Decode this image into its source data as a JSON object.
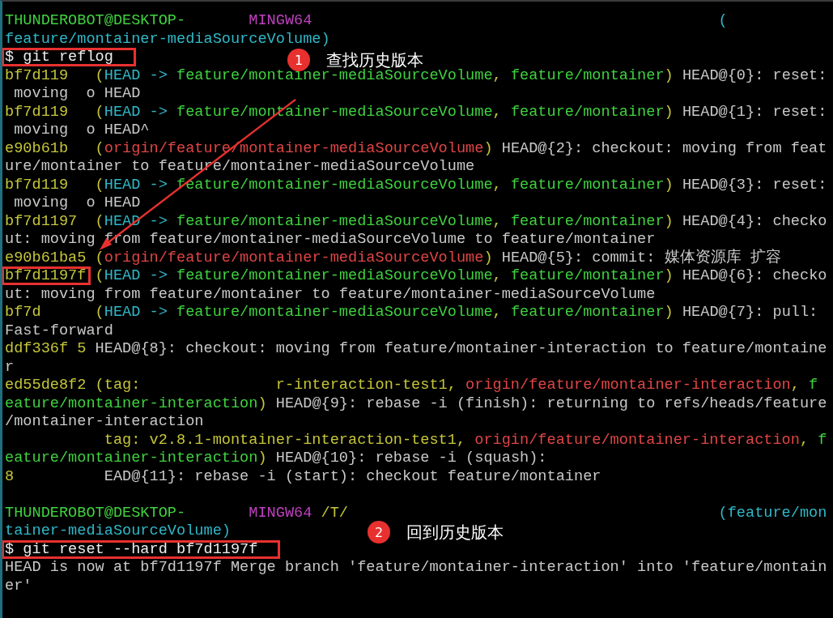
{
  "terminal": {
    "lines": [
      {
        "boxed": false,
        "segments": [
          {
            "text": "THUNDEROBOT@DESKTOP-",
            "color": "#3fd23f"
          },
          {
            "text": "       MINGW64",
            "color": "#c040c0"
          },
          {
            "text": "                                             (",
            "color": "#2fb8c8"
          }
        ]
      },
      {
        "boxed": false,
        "segments": [
          {
            "text": "feature/montainer-mediaSourceVolume)",
            "color": "#2fb8c8"
          }
        ]
      },
      {
        "boxed": true,
        "segments": [
          {
            "text": "$ git reflog",
            "color": "#ececec"
          }
        ]
      },
      {
        "boxed": false,
        "segments": [
          {
            "text": "bf7d119   (",
            "color": "#c5c53a"
          },
          {
            "text": "HEAD -> ",
            "color": "#2fb8c8"
          },
          {
            "text": "feature/montainer-mediaSourceVolume",
            "color": "#3fd23f"
          },
          {
            "text": ", ",
            "color": "#c5c53a"
          },
          {
            "text": "feature/montainer",
            "color": "#3fd23f"
          },
          {
            "text": ")",
            "color": "#c5c53a"
          },
          {
            "text": " HEAD@{0}: reset:",
            "color": "#c8c8c8"
          }
        ]
      },
      {
        "boxed": false,
        "segments": [
          {
            "text": " moving  o HEAD",
            "color": "#c8c8c8"
          }
        ]
      },
      {
        "boxed": false,
        "segments": [
          {
            "text": "bf7d119   (",
            "color": "#c5c53a"
          },
          {
            "text": "HEAD -> ",
            "color": "#2fb8c8"
          },
          {
            "text": "feature/montainer-mediaSourceVolume",
            "color": "#3fd23f"
          },
          {
            "text": ", ",
            "color": "#c5c53a"
          },
          {
            "text": "feature/montainer",
            "color": "#3fd23f"
          },
          {
            "text": ")",
            "color": "#c5c53a"
          },
          {
            "text": " HEAD@{1}: reset:",
            "color": "#c8c8c8"
          }
        ]
      },
      {
        "boxed": false,
        "segments": [
          {
            "text": " moving  o HEAD^",
            "color": "#c8c8c8"
          }
        ]
      },
      {
        "boxed": false,
        "segments": [
          {
            "text": "e90b61b   (",
            "color": "#c5c53a"
          },
          {
            "text": "origin/feature/montainer-mediaSourceVolume",
            "color": "#e04545"
          },
          {
            "text": ")",
            "color": "#c5c53a"
          },
          {
            "text": " HEAD@{2}: checkout: moving from feat",
            "color": "#c8c8c8"
          }
        ]
      },
      {
        "boxed": false,
        "segments": [
          {
            "text": "ure/montainer to feature/montainer-mediaSourceVolume",
            "color": "#c8c8c8"
          }
        ]
      },
      {
        "boxed": false,
        "segments": [
          {
            "text": "bf7d119   (",
            "color": "#c5c53a"
          },
          {
            "text": "HEAD -> ",
            "color": "#2fb8c8"
          },
          {
            "text": "feature/montainer-mediaSourceVolume",
            "color": "#3fd23f"
          },
          {
            "text": ", ",
            "color": "#c5c53a"
          },
          {
            "text": "feature/montainer",
            "color": "#3fd23f"
          },
          {
            "text": ")",
            "color": "#c5c53a"
          },
          {
            "text": " HEAD@{3}: reset:",
            "color": "#c8c8c8"
          }
        ]
      },
      {
        "boxed": false,
        "segments": [
          {
            "text": " moving  o HEAD",
            "color": "#c8c8c8"
          }
        ]
      },
      {
        "boxed": false,
        "segments": [
          {
            "text": "bf7d1197  (",
            "color": "#c5c53a"
          },
          {
            "text": "HEAD -> ",
            "color": "#2fb8c8"
          },
          {
            "text": "feature/montainer-mediaSourceVolume",
            "color": "#3fd23f"
          },
          {
            "text": ", ",
            "color": "#c5c53a"
          },
          {
            "text": "feature/montainer",
            "color": "#3fd23f"
          },
          {
            "text": ")",
            "color": "#c5c53a"
          },
          {
            "text": " HEAD@{4}: checko",
            "color": "#c8c8c8"
          }
        ]
      },
      {
        "boxed": false,
        "segments": [
          {
            "text": "ut: moving from feature/montainer-mediaSourceVolume to feature/montainer",
            "color": "#c8c8c8"
          }
        ]
      },
      {
        "boxed": false,
        "segments": [
          {
            "text": "e90b61ba5 (",
            "color": "#c5c53a"
          },
          {
            "text": "origin/feature/montainer-mediaSourceVolume",
            "color": "#e04545"
          },
          {
            "text": ")",
            "color": "#c5c53a"
          },
          {
            "text": " HEAD@{5}: commit: 媒体资源库 扩容",
            "color": "#c8c8c8"
          }
        ]
      },
      {
        "boxed": true,
        "segments": [
          {
            "text": "bf7d1197f",
            "color": "#c5c53a"
          },
          {
            "text": " (",
            "color": "#c5c53a"
          },
          {
            "text": "HEAD -> ",
            "color": "#2fb8c8"
          },
          {
            "text": "feature/montainer-mediaSourceVolume",
            "color": "#3fd23f"
          },
          {
            "text": ", ",
            "color": "#c5c53a"
          },
          {
            "text": "feature/montainer",
            "color": "#3fd23f"
          },
          {
            "text": ")",
            "color": "#c5c53a"
          },
          {
            "text": " HEAD@{6}: checko",
            "color": "#c8c8c8"
          }
        ]
      },
      {
        "boxed": false,
        "segments": [
          {
            "text": "ut: moving from feature/montainer to feature/montainer-mediaSourceVolume",
            "color": "#c8c8c8"
          }
        ]
      },
      {
        "boxed": false,
        "segments": [
          {
            "text": "bf7d      (",
            "color": "#c5c53a"
          },
          {
            "text": "HEAD -> ",
            "color": "#2fb8c8"
          },
          {
            "text": "feature/montainer-mediaSourceVolume",
            "color": "#3fd23f"
          },
          {
            "text": ", ",
            "color": "#c5c53a"
          },
          {
            "text": "feature/montainer",
            "color": "#3fd23f"
          },
          {
            "text": ")",
            "color": "#c5c53a"
          },
          {
            "text": " HEAD@{7}: pull:",
            "color": "#c8c8c8"
          }
        ]
      },
      {
        "boxed": false,
        "segments": [
          {
            "text": "Fast-forward",
            "color": "#c8c8c8"
          }
        ]
      },
      {
        "boxed": false,
        "segments": [
          {
            "text": "ddf336f 5",
            "color": "#c5c53a"
          },
          {
            "text": " HEAD@{8}: checkout: moving from feature/montainer-interaction to feature/montaine",
            "color": "#c8c8c8"
          }
        ]
      },
      {
        "boxed": false,
        "segments": [
          {
            "text": "r",
            "color": "#c8c8c8"
          }
        ]
      },
      {
        "boxed": false,
        "segments": [
          {
            "text": "ed55de8f2 (tag:               r-interaction-test1",
            "color": "#c5c53a"
          },
          {
            "text": ", ",
            "color": "#c5c53a"
          },
          {
            "text": "origin/feature/montainer-interaction",
            "color": "#e04545"
          },
          {
            "text": ", ",
            "color": "#c5c53a"
          },
          {
            "text": "f",
            "color": "#3fd23f"
          }
        ]
      },
      {
        "boxed": false,
        "segments": [
          {
            "text": "eature/montainer-interaction",
            "color": "#3fd23f"
          },
          {
            "text": ")",
            "color": "#c5c53a"
          },
          {
            "text": " HEAD@{9}: rebase -i (finish): returning to refs/heads/feature",
            "color": "#c8c8c8"
          }
        ]
      },
      {
        "boxed": false,
        "segments": [
          {
            "text": "/montainer-interaction",
            "color": "#c8c8c8"
          }
        ]
      },
      {
        "boxed": false,
        "segments": [
          {
            "text": "           tag: v2.8.1-montainer-interaction-test1",
            "color": "#c5c53a"
          },
          {
            "text": ", ",
            "color": "#c5c53a"
          },
          {
            "text": "origin/feature/montainer-interaction",
            "color": "#e04545"
          },
          {
            "text": ", ",
            "color": "#c5c53a"
          },
          {
            "text": "f",
            "color": "#3fd23f"
          }
        ]
      },
      {
        "boxed": false,
        "segments": [
          {
            "text": "eature/montainer-interaction",
            "color": "#3fd23f"
          },
          {
            "text": ")",
            "color": "#c5c53a"
          },
          {
            "text": " HEAD@{10}: rebase -i (squash):",
            "color": "#c8c8c8"
          }
        ]
      },
      {
        "boxed": false,
        "segments": [
          {
            "text": "8",
            "color": "#c5c53a"
          },
          {
            "text": "          EAD@{11}: rebase -i (start): checkout feature/montainer",
            "color": "#c8c8c8"
          }
        ]
      },
      {
        "boxed": false
      },
      {
        "boxed": false,
        "segments": [
          {
            "text": "THUNDEROBOT@DESKTOP-",
            "color": "#3fd23f"
          },
          {
            "text": "       MINGW64",
            "color": "#c040c0"
          },
          {
            "text": " /T/",
            "color": "#c5c53a"
          },
          {
            "text": "                                         (feature/mon",
            "color": "#2fb8c8"
          }
        ]
      },
      {
        "boxed": false,
        "segments": [
          {
            "text": "tainer-mediaSourceVolume)",
            "color": "#2fb8c8"
          }
        ]
      },
      {
        "boxed": true,
        "segments": [
          {
            "text": "$ git reset --hard bf7d1197f",
            "color": "#ececec"
          }
        ]
      },
      {
        "boxed": false,
        "segments": [
          {
            "text": "HEAD is now at bf7d1197f Merge branch 'feature/montainer-interaction' into 'feature/montain",
            "color": "#c8c8c8"
          }
        ]
      },
      {
        "boxed": false,
        "segments": [
          {
            "text": "er'",
            "color": "#c8c8c8"
          }
        ]
      }
    ]
  },
  "annotations": [
    {
      "number": "1",
      "label": "查找历史版本"
    },
    {
      "number": "2",
      "label": "回到历史版本"
    }
  ]
}
